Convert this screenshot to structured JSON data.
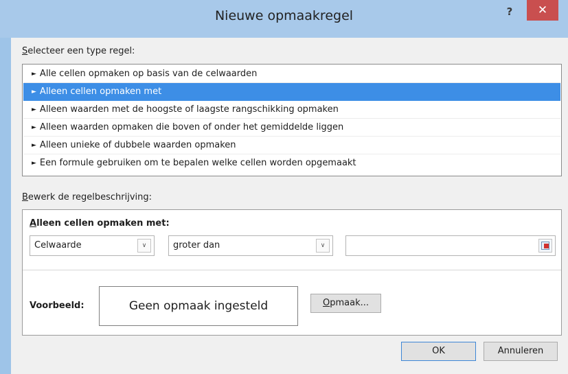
{
  "window": {
    "title": "Nieuwe opmaakregel",
    "help_glyph": "?",
    "close_glyph": "✕"
  },
  "rule_type": {
    "label_accel": "S",
    "label_rest": "electeer een type regel:",
    "items": [
      {
        "label": "Alle cellen opmaken op basis van de celwaarden",
        "selected": false
      },
      {
        "label": "Alleen cellen opmaken met",
        "selected": true
      },
      {
        "label": "Alleen waarden met de hoogste of laagste rangschikking opmaken",
        "selected": false
      },
      {
        "label": "Alleen waarden opmaken die boven of onder het gemiddelde liggen",
        "selected": false
      },
      {
        "label": "Alleen unieke of dubbele waarden opmaken",
        "selected": false
      },
      {
        "label": "Een formule gebruiken om te bepalen welke cellen worden opgemaakt",
        "selected": false
      }
    ],
    "arrow_glyph": "►"
  },
  "description": {
    "label_accel": "B",
    "label_rest": "ewerk de regelbeschrijving:",
    "title_accel": "A",
    "title_rest": "lleen cellen opmaken met:",
    "condition_type": "Celwaarde",
    "operator": "groter dan",
    "value": "",
    "dropdown_glyph": "∨",
    "preview_label": "Voorbeeld:",
    "preview_text": "Geen opmaak ingesteld",
    "format_button_accel": "O",
    "format_button_rest": "pmaak..."
  },
  "footer": {
    "ok_label": "OK",
    "cancel_label": "Annuleren"
  },
  "colors": {
    "selection": "#3d8ee6",
    "title_bar": "#a8c9ea",
    "close_button": "#c94f4f"
  }
}
